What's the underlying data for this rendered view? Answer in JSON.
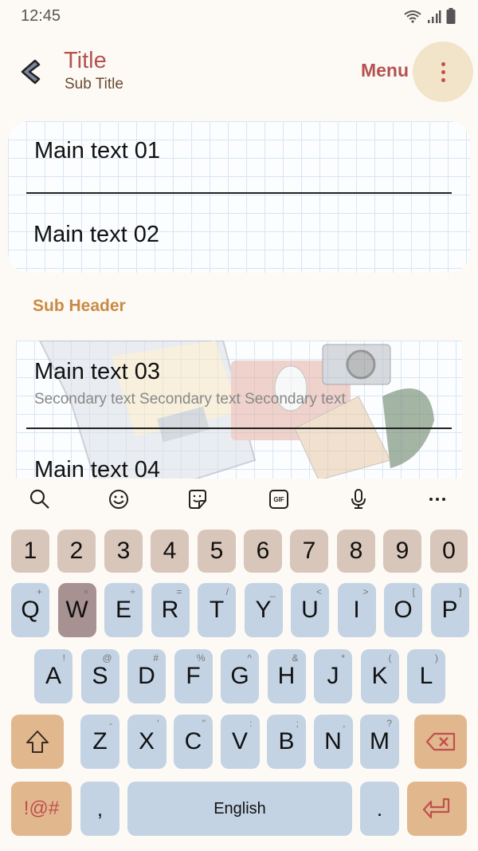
{
  "status_bar": {
    "time": "12:45",
    "icons": [
      "wifi-icon",
      "signal-icon",
      "battery-icon"
    ]
  },
  "app_bar": {
    "back_icon": "back-chevron-icon",
    "title": "Title",
    "subtitle": "Sub Title",
    "menu_label": "Menu",
    "more_icon": "more-vertical-icon"
  },
  "list_top": {
    "items": [
      {
        "main": "Main text 01"
      },
      {
        "main": "Main text 02"
      }
    ]
  },
  "sub_header": "Sub Header",
  "list_bottom": {
    "items": [
      {
        "main": "Main text 03",
        "secondary": "Secondary text Secondary text Secondary text"
      },
      {
        "main": "Main text 04"
      }
    ]
  },
  "keyboard": {
    "toolbar": [
      "search-icon",
      "emoji-icon",
      "sticker-icon",
      "gif-icon",
      "mic-icon",
      "more-horizontal-icon"
    ],
    "gif_label": "GIF",
    "number_row": [
      "1",
      "2",
      "3",
      "4",
      "5",
      "6",
      "7",
      "8",
      "9",
      "0"
    ],
    "row1": [
      {
        "key": "Q",
        "hint": "+"
      },
      {
        "key": "W",
        "hint": "×"
      },
      {
        "key": "E",
        "hint": "÷"
      },
      {
        "key": "R",
        "hint": "="
      },
      {
        "key": "T",
        "hint": "/"
      },
      {
        "key": "Y",
        "hint": "_"
      },
      {
        "key": "U",
        "hint": "<"
      },
      {
        "key": "I",
        "hint": ">"
      },
      {
        "key": "O",
        "hint": "["
      },
      {
        "key": "P",
        "hint": "]"
      }
    ],
    "row2": [
      {
        "key": "A",
        "hint": "!"
      },
      {
        "key": "S",
        "hint": "@"
      },
      {
        "key": "D",
        "hint": "#"
      },
      {
        "key": "F",
        "hint": "%"
      },
      {
        "key": "G",
        "hint": "^"
      },
      {
        "key": "H",
        "hint": "&"
      },
      {
        "key": "J",
        "hint": "*"
      },
      {
        "key": "K",
        "hint": "("
      },
      {
        "key": "L",
        "hint": ")"
      }
    ],
    "row3": [
      {
        "key": "Z",
        "hint": "-"
      },
      {
        "key": "X",
        "hint": "'"
      },
      {
        "key": "C",
        "hint": "\""
      },
      {
        "key": "V",
        "hint": ":"
      },
      {
        "key": "B",
        "hint": ";"
      },
      {
        "key": "N",
        "hint": ","
      },
      {
        "key": "M",
        "hint": "?"
      }
    ],
    "pressed_key": "W",
    "symbols_label": "!@#",
    "comma_label": ",",
    "space_label": "English",
    "period_label": ".",
    "colors": {
      "letter_key": "#c3d3e4",
      "number_key": "#d8c6bb",
      "function_key": "#e1b78e",
      "pressed_key": "#a89291",
      "accent_red": "#c0504d"
    }
  }
}
